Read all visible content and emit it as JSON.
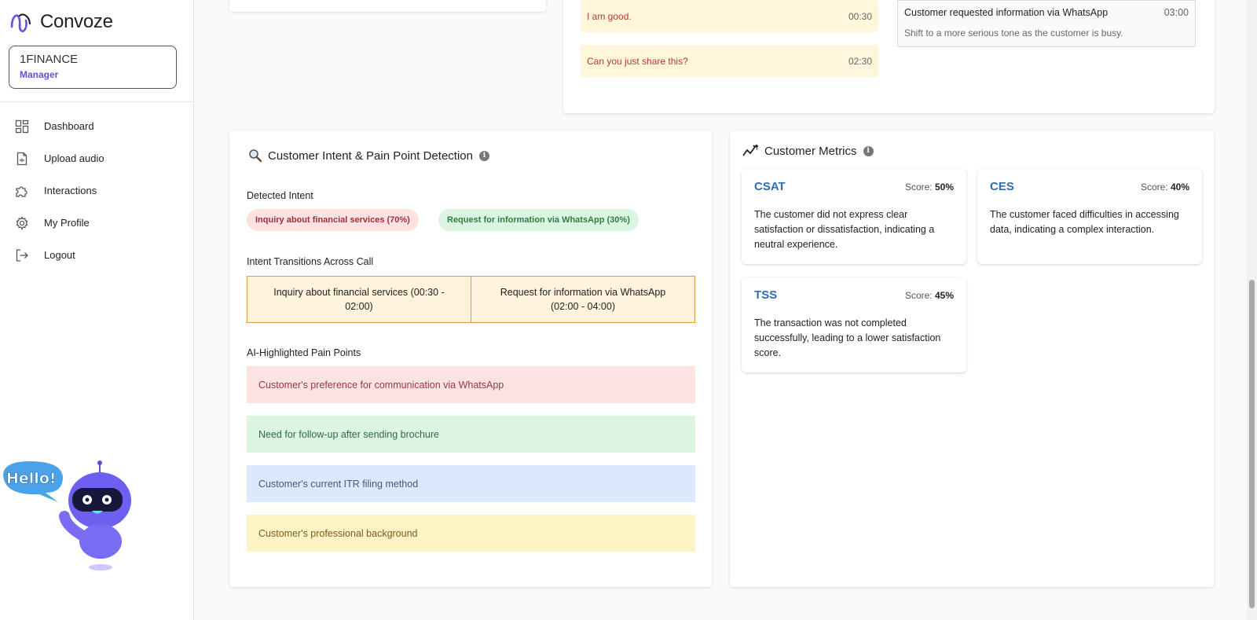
{
  "brand": {
    "name": "Convoze"
  },
  "org": {
    "name": "1FINANCE",
    "role": "Manager"
  },
  "nav": [
    {
      "label": "Dashboard",
      "icon": "dashboard-icon"
    },
    {
      "label": "Upload audio",
      "icon": "file-audio-icon"
    },
    {
      "label": "Interactions",
      "icon": "puzzle-icon"
    },
    {
      "label": "My Profile",
      "icon": "gear-icon"
    },
    {
      "label": "Logout",
      "icon": "logout-icon"
    }
  ],
  "mascot": {
    "speech": "Hello!"
  },
  "transcript": [
    {
      "text": "I am good.",
      "time": "00:30"
    },
    {
      "text": "Can you just share this?",
      "time": "02:30"
    }
  ],
  "event": {
    "title": "Customer requested information via WhatsApp",
    "time": "03:00",
    "note": "Shift to a more serious tone as the customer is busy."
  },
  "intent": {
    "title": "Customer Intent & Pain Point Detection",
    "detected_label": "Detected Intent",
    "detected": [
      {
        "text": "Inquiry about financial services (70%)",
        "color": "red"
      },
      {
        "text": "Request for information via WhatsApp (30%)",
        "color": "green"
      }
    ],
    "transitions_label": "Intent Transitions Across Call",
    "transitions": [
      "Inquiry about financial services  (00:30 - 02:00)",
      "Request for information via WhatsApp (02:00 - 04:00)"
    ],
    "pain_label": "AI-Highlighted Pain Points",
    "pain_points": [
      "Customer's preference for communication via WhatsApp",
      "Need for follow-up after sending brochure",
      "Customer's current ITR filing method",
      "Customer's professional background"
    ]
  },
  "metrics": {
    "title": "Customer Metrics",
    "score_prefix": "Score:",
    "items": [
      {
        "name": "CSAT",
        "score": "50%",
        "desc": "The customer did not express clear satisfaction or dissatisfaction, indicating a neutral experience."
      },
      {
        "name": "CES",
        "score": "40%",
        "desc": "The customer faced difficulties in accessing data, indicating a complex interaction."
      },
      {
        "name": "TSS",
        "score": "45%",
        "desc": "The transaction was not completed successfully, leading to a lower satisfaction score."
      }
    ]
  },
  "colors": {
    "accent": "#5a54d6",
    "metric_name": "#2f6cb3"
  }
}
